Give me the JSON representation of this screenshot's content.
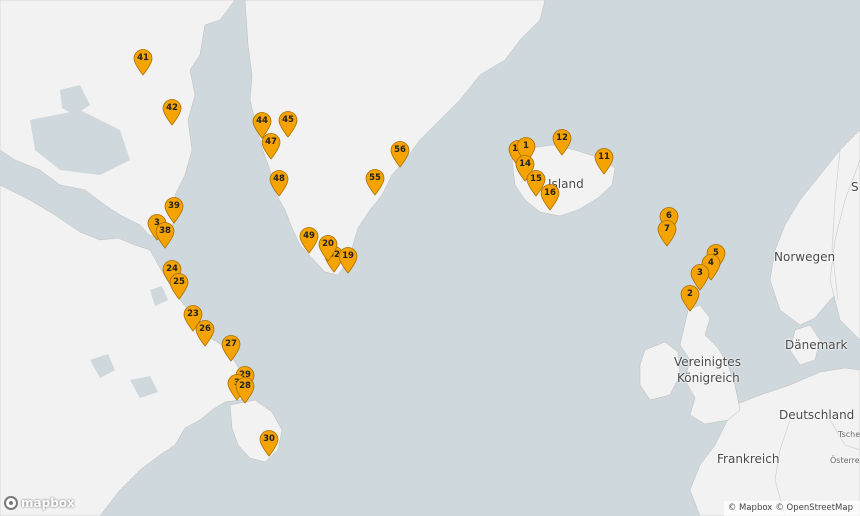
{
  "map": {
    "colors": {
      "water": "#cfd8dc",
      "land": "#f2f2f2",
      "border": "#bdbdbd",
      "marker_fill": "#f5a300",
      "marker_stroke": "#a86d00",
      "label_text": "#555555"
    },
    "labels": {
      "iceland": "Island",
      "norway": "Norwegen",
      "uk_line1": "Vereinigtes",
      "uk_line2": "Königreich",
      "denmark": "Dänemark",
      "germany": "Deutschland",
      "france": "Frankreich",
      "czech_partial": "Tsche",
      "austria_partial": "Österrei",
      "sweden_partial": "S"
    },
    "markers": [
      {
        "label": "41"
      },
      {
        "label": "42"
      },
      {
        "label": "44"
      },
      {
        "label": "45"
      },
      {
        "label": "47"
      },
      {
        "label": "48"
      },
      {
        "label": "56"
      },
      {
        "label": "55"
      },
      {
        "label": "39"
      },
      {
        "label": "3"
      },
      {
        "label": "38"
      },
      {
        "label": "49"
      },
      {
        "label": "52"
      },
      {
        "label": "20"
      },
      {
        "label": "19"
      },
      {
        "label": "24"
      },
      {
        "label": "25"
      },
      {
        "label": "23"
      },
      {
        "label": "26"
      },
      {
        "label": "27"
      },
      {
        "label": "29"
      },
      {
        "label": "3"
      },
      {
        "label": "28"
      },
      {
        "label": "30"
      },
      {
        "label": "13"
      },
      {
        "label": "1"
      },
      {
        "label": "14"
      },
      {
        "label": "12"
      },
      {
        "label": "15"
      },
      {
        "label": "16"
      },
      {
        "label": "11"
      },
      {
        "label": "6"
      },
      {
        "label": "7"
      },
      {
        "label": "5"
      },
      {
        "label": "4"
      },
      {
        "label": "3"
      },
      {
        "label": "2"
      }
    ]
  },
  "logo": {
    "text": "mapbox"
  },
  "attribution": {
    "mapbox": "© Mapbox",
    "osm": "© OpenStreetMap"
  }
}
